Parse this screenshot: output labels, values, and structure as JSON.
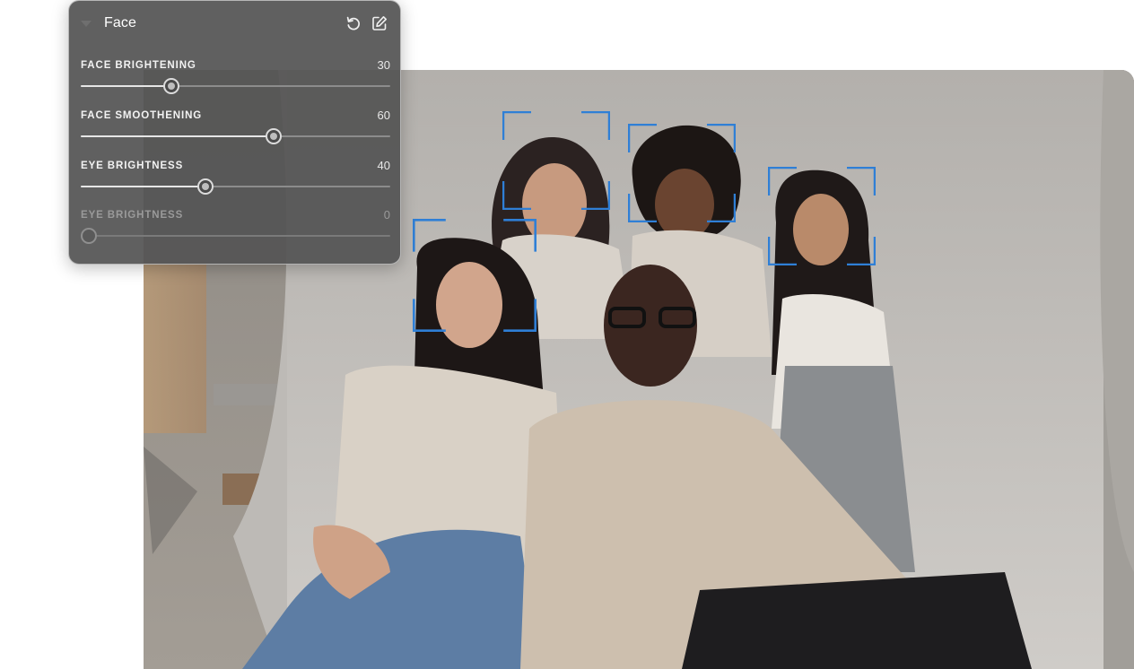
{
  "panel": {
    "title": "Face",
    "icons": {
      "collapse": "chevron-down-icon",
      "reset": "reset-icon",
      "edit": "edit-icon"
    },
    "sliders": [
      {
        "label": "FACE BRIGHTENING",
        "value": "30",
        "fraction": 0.29,
        "enabled": true
      },
      {
        "label": "FACE SMOOTHENING",
        "value": "60",
        "fraction": 0.62,
        "enabled": true
      },
      {
        "label": "EYE BRIGHTNESS",
        "value": "40",
        "fraction": 0.4,
        "enabled": true
      },
      {
        "label": "EYE BRIGHTNESS",
        "value": "0",
        "fraction": 0.0,
        "enabled": false
      }
    ]
  },
  "photo": {
    "subject": "group-portrait",
    "detected_faces": 4,
    "face_box_color": "#2f7fd6"
  },
  "colors": {
    "panel_bg": "#545454",
    "track": "#8c8c8c",
    "track_fill": "#e6e6e6"
  }
}
